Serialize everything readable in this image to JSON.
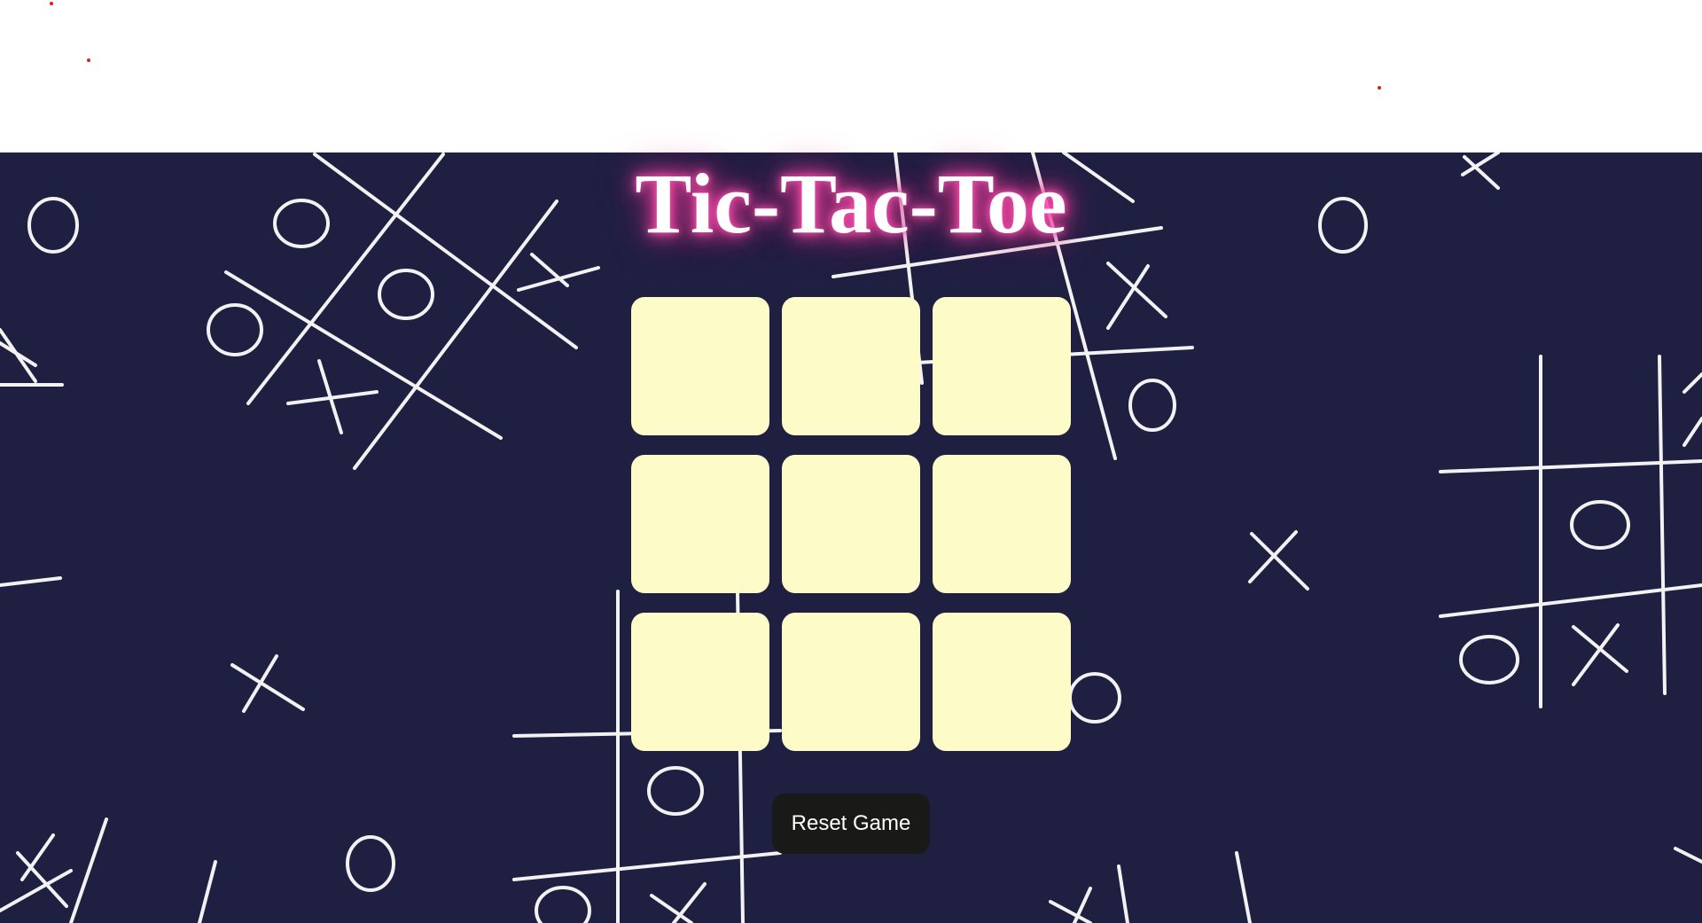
{
  "title": "Tic-Tac-Toe",
  "board": {
    "cells": [
      "",
      "",
      "",
      "",
      "",
      "",
      "",
      "",
      ""
    ]
  },
  "reset_label": "Reset Game",
  "colors": {
    "background": "#1f1f42",
    "cell": "#fdfcc8",
    "glow": "#ff4fb0",
    "button": "#191917",
    "dots": "#d42020"
  }
}
